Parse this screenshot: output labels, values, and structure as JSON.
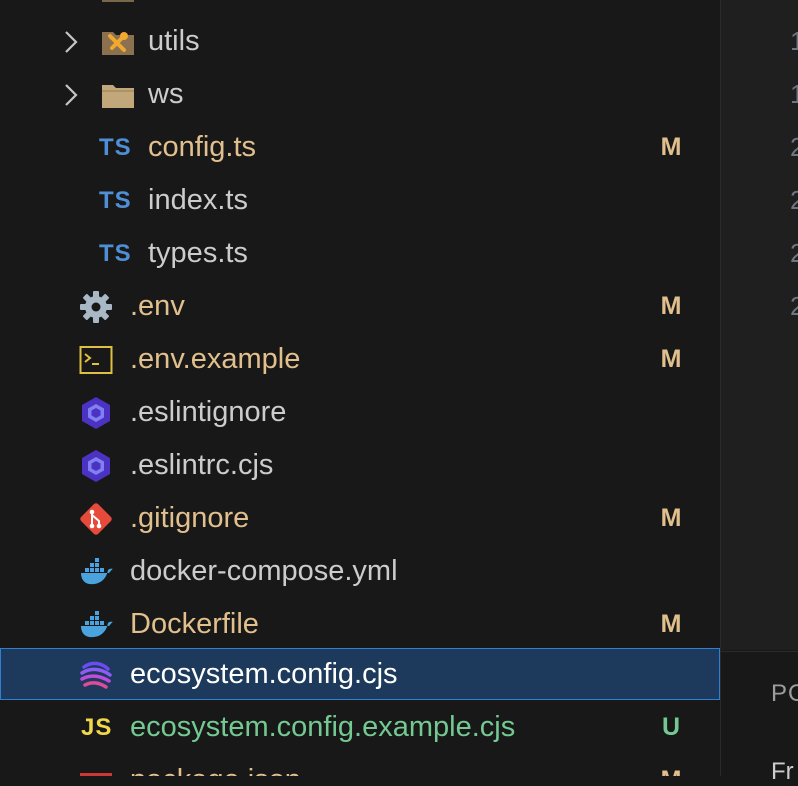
{
  "editor": {
    "line_numbers": [
      "1",
      "1",
      "2",
      "2",
      "2",
      "2"
    ]
  },
  "panel": {
    "tab_label": "PO",
    "text": "Fr"
  },
  "explorer": {
    "items": [
      {
        "name": "",
        "kind": "folder-partial"
      },
      {
        "name": "utils",
        "kind": "folder",
        "icon": "tools-folder-icon"
      },
      {
        "name": "ws",
        "kind": "folder",
        "icon": "folder-icon"
      },
      {
        "name": "config.ts",
        "kind": "ts",
        "type_label": "TS",
        "status": "M"
      },
      {
        "name": "index.ts",
        "kind": "ts",
        "type_label": "TS",
        "status": ""
      },
      {
        "name": "types.ts",
        "kind": "ts",
        "type_label": "TS",
        "status": ""
      },
      {
        "name": ".env",
        "kind": "file",
        "icon": "gear-icon",
        "status": "M"
      },
      {
        "name": ".env.example",
        "kind": "file",
        "icon": "terminal-icon",
        "status": "M"
      },
      {
        "name": ".eslintignore",
        "kind": "file",
        "icon": "eslint-icon",
        "status": ""
      },
      {
        "name": ".eslintrc.cjs",
        "kind": "file",
        "icon": "eslint-icon",
        "status": ""
      },
      {
        "name": ".gitignore",
        "kind": "file",
        "icon": "git-icon",
        "status": "M"
      },
      {
        "name": "docker-compose.yml",
        "kind": "file",
        "icon": "docker-icon",
        "status": ""
      },
      {
        "name": "Dockerfile",
        "kind": "file",
        "icon": "docker-icon",
        "status": "M"
      },
      {
        "name": "ecosystem.config.cjs",
        "kind": "file",
        "icon": "pm2-icon",
        "status": "",
        "selected": true
      },
      {
        "name": "ecosystem.config.example.cjs",
        "kind": "js",
        "type_label": "JS",
        "status": "U"
      },
      {
        "name": "package.json",
        "kind": "file",
        "icon": "npm-icon",
        "status": "M"
      }
    ]
  },
  "colors": {
    "modified": "#e2c08d",
    "untracked": "#73c991",
    "selected_bg": "#1d3a5c",
    "selected_border": "#2f7fd4",
    "ts": "#4f8fd8",
    "js": "#f0d84c"
  }
}
